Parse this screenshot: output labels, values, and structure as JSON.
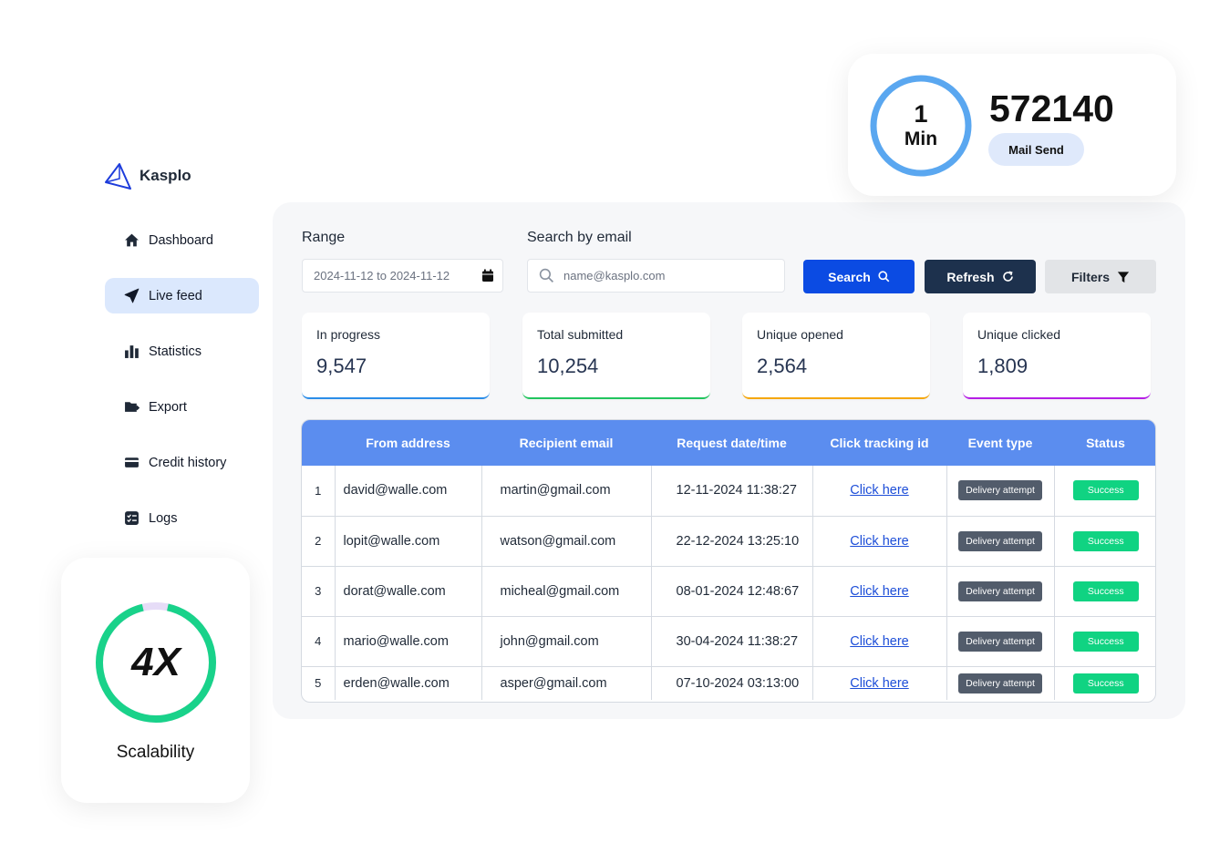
{
  "brand": {
    "name": "Kasplo",
    "color": "#1d3cdb"
  },
  "sidebar": {
    "items": [
      {
        "label": "Dashboard",
        "icon": "home-icon"
      },
      {
        "label": "Live feed",
        "icon": "send-icon",
        "active": true
      },
      {
        "label": "Statistics",
        "icon": "bar-chart-icon"
      },
      {
        "label": "Export",
        "icon": "folder-export-icon"
      },
      {
        "label": "Credit history",
        "icon": "credit-card-icon"
      },
      {
        "label": "Logs",
        "icon": "checklist-icon"
      }
    ]
  },
  "filters": {
    "range_label": "Range",
    "range_value": "2024-11-12 to 2024-11-12",
    "search_label": "Search by email",
    "search_placeholder": "name@kasplo.com",
    "search_button": "Search",
    "refresh_button": "Refresh",
    "filters_button": "Filters"
  },
  "stats": [
    {
      "label": "In progress",
      "value": "9,547",
      "color": "#2b8de8"
    },
    {
      "label": "Total submitted",
      "value": "10,254",
      "color": "#22c55e"
    },
    {
      "label": "Unique opened",
      "value": "2,564",
      "color": "#f5a70b"
    },
    {
      "label": "Unique clicked",
      "value": "1,809",
      "color": "#b51ee6"
    }
  ],
  "table": {
    "headers": [
      "",
      "From address",
      "Recipient email",
      "Request date/time",
      "Click tracking id",
      "Event type",
      "Status"
    ],
    "rows": [
      {
        "n": "1",
        "from": "david@walle.com",
        "to": "martin@gmail.com",
        "date": "12-11-2024 11:38:27",
        "click": "Click here",
        "event": "Delivery attempt",
        "status": "Success"
      },
      {
        "n": "2",
        "from": "lopit@walle.com",
        "to": "watson@gmail.com",
        "date": "22-12-2024 13:25:10",
        "click": "Click here",
        "event": "Delivery attempt",
        "status": "Success"
      },
      {
        "n": "3",
        "from": "dorat@walle.com",
        "to": "micheal@gmail.com",
        "date": "08-01-2024 12:48:67",
        "click": "Click here",
        "event": "Delivery attempt",
        "status": "Success"
      },
      {
        "n": "4",
        "from": "mario@walle.com",
        "to": "john@gmail.com",
        "date": "30-04-2024 11:38:27",
        "click": "Click here",
        "event": "Delivery attempt",
        "status": "Success"
      },
      {
        "n": "5",
        "from": "erden@walle.com",
        "to": "asper@gmail.com",
        "date": "07-10-2024 03:13:00",
        "click": "Click here",
        "event": "Delivery attempt",
        "status": "Success"
      }
    ]
  },
  "mail_card": {
    "ring_line1": "1",
    "ring_line2": "Min",
    "count": "572140",
    "pill": "Mail Send",
    "ring_color": "#5aa7f0"
  },
  "scale_card": {
    "value": "4X",
    "label": "Scalability",
    "ring_color": "#19d28a",
    "ring_bg": "#e6dcf7"
  }
}
